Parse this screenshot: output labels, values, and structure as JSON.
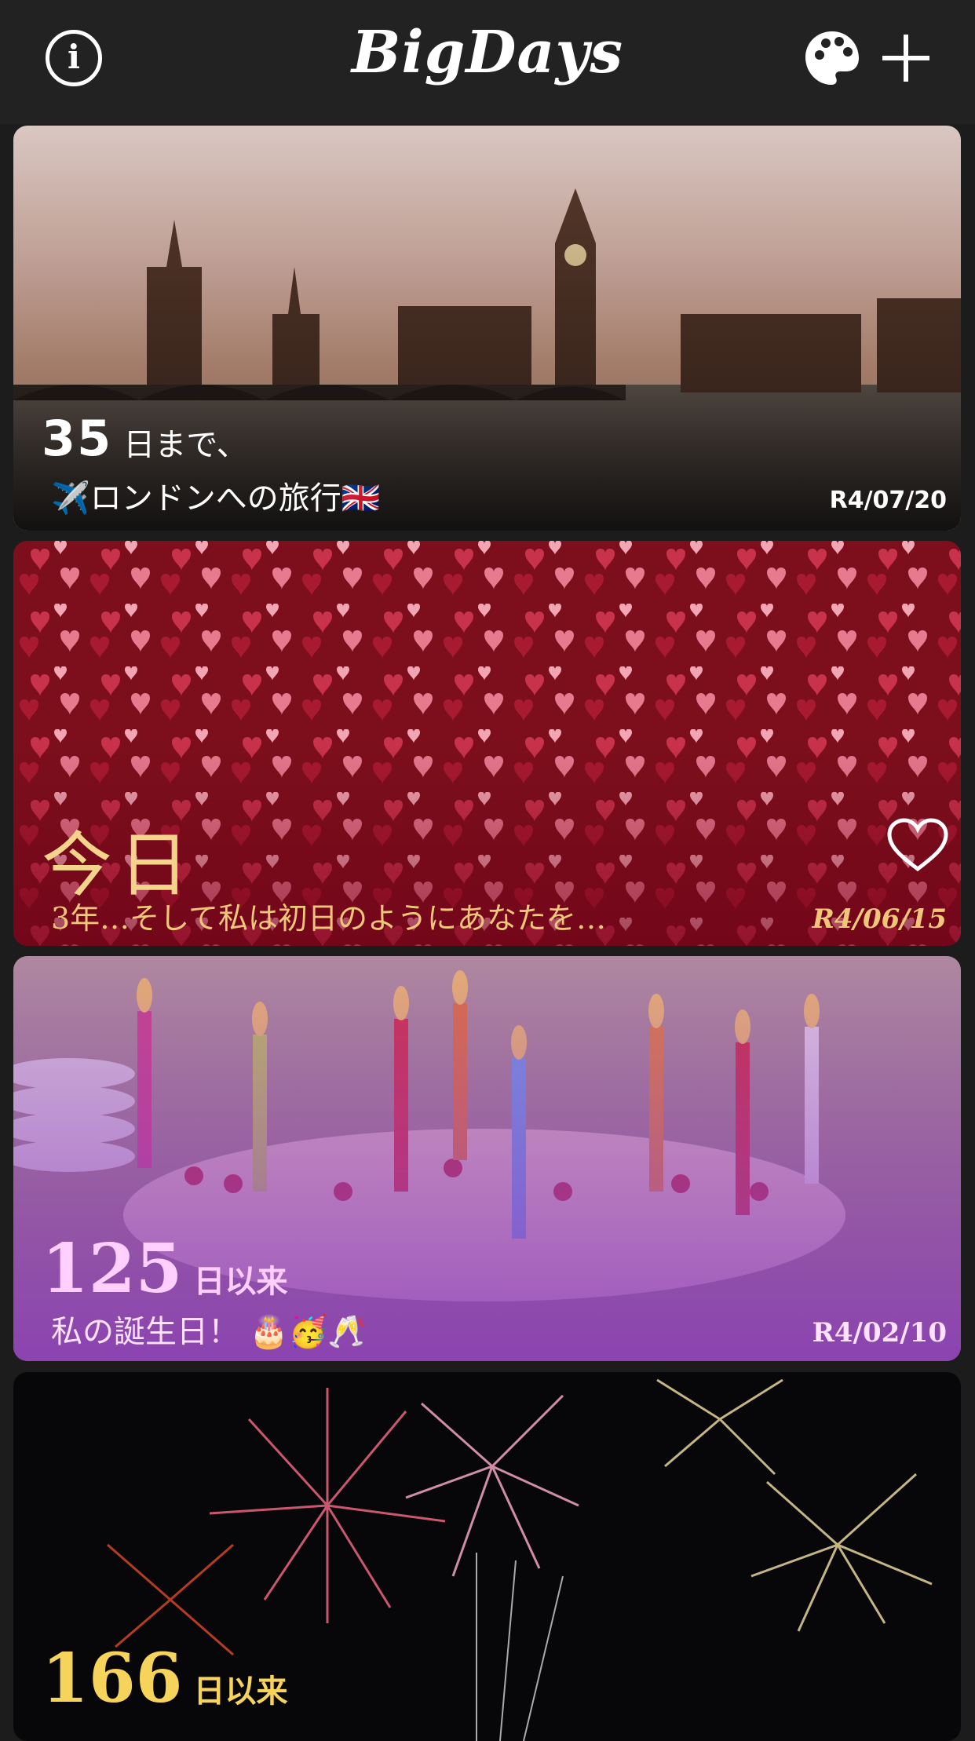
{
  "app": {
    "title": "BigDays"
  },
  "header": {
    "info_icon": "info-circle-icon",
    "info_glyph": "i",
    "palette_icon": "palette-icon",
    "add_icon": "plus-icon"
  },
  "cards": [
    {
      "count": "35",
      "unit": "日まで、",
      "title": "✈️ロンドンへの旅行🇬🇧",
      "date": "R4/07/20",
      "theme_color": "#ffffff"
    },
    {
      "count": "今日",
      "title": "3年…そして私は初日のようにあなたを…",
      "date": "R4/06/15",
      "theme_color": "#f0c77a",
      "favorite_icon": "heart-outline-icon"
    },
    {
      "count": "125",
      "unit": "日以来",
      "title": "私の誕生日！ 🎂🥳🥂",
      "date": "R4/02/10",
      "theme_color": "#a450c8"
    },
    {
      "count": "166",
      "unit": "日以来",
      "theme_color": "#f6d35a"
    }
  ]
}
